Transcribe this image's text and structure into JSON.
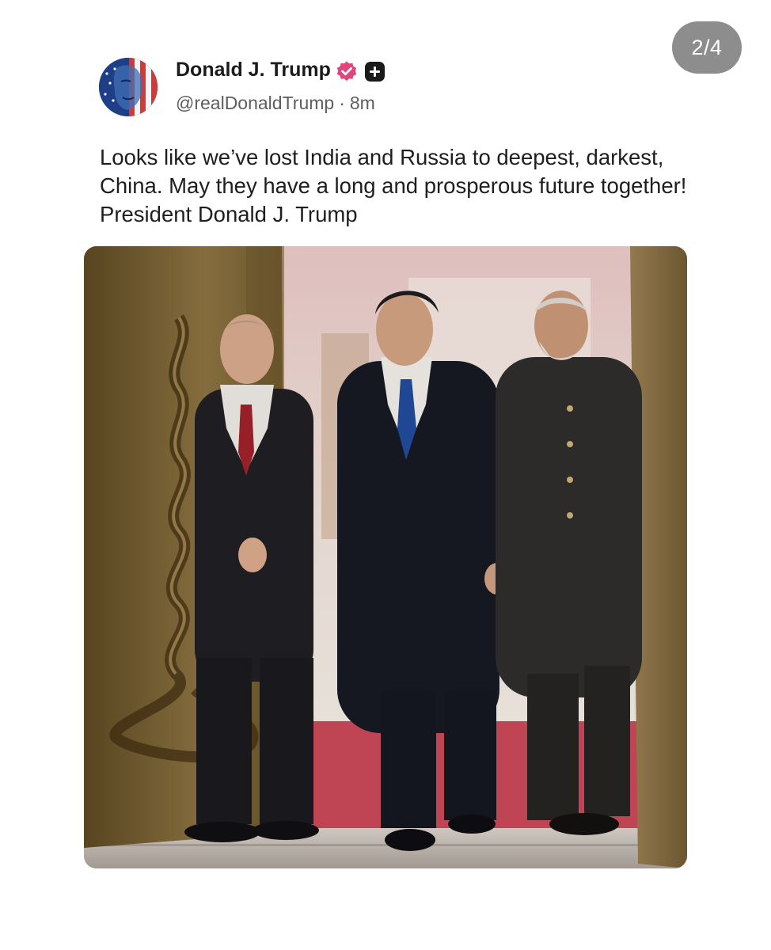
{
  "viewer": {
    "counter": "2/4"
  },
  "post": {
    "author": {
      "display_name": "Donald J. Trump",
      "handle": "@realDonaldTrump",
      "separator": "·",
      "time_ago": "8m",
      "avatar_icon": "flag-face-avatar",
      "verified_icon": "verified-badge-icon",
      "verified_color": "#e0457b",
      "plus_icon": "plus-badge-icon"
    },
    "text": "Looks like we’ve lost India and Russia to deepest, darkest, China. May they have a long and prosperous future together! President Donald J. Trump",
    "media": {
      "type": "photo",
      "accent_colors": {
        "carpet": "#c84a5c",
        "door_gold": "#8a7240"
      }
    }
  }
}
